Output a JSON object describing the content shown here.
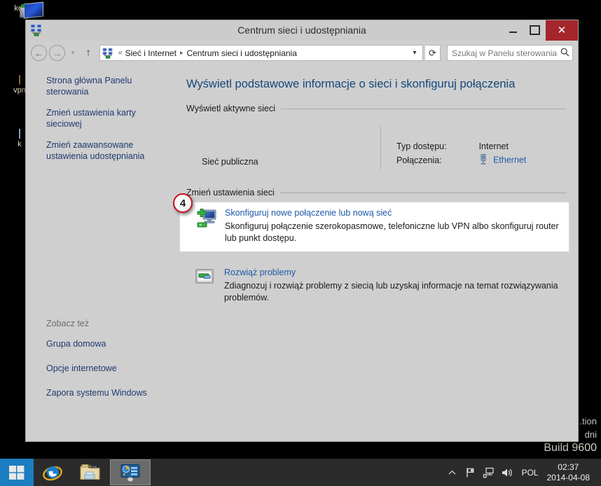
{
  "desktop": {
    "icons": [
      {
        "name": "komputer-icon",
        "label": "kor",
        "glyph": "monitor"
      },
      {
        "name": "vpn-folder-icon",
        "label": "vpn",
        "glyph": "folder"
      },
      {
        "name": "unknown-icon",
        "label": "k",
        "glyph": "blue"
      }
    ],
    "watermark": {
      "line1": "...tion",
      "line2": "dni",
      "build": "Build 9600"
    }
  },
  "window": {
    "title": "Centrum sieci i udostępniania",
    "app_icon": "network-icon",
    "controls": {
      "minimize": "–",
      "maximize": "❐",
      "close": "✕"
    },
    "toolbar": {
      "back": "←",
      "forward": "→",
      "recent_caret": "▾",
      "up": "↑",
      "refresh": "⟳"
    },
    "breadcrumb": {
      "icon": "network-icon",
      "overflow": "«",
      "items": [
        "Sieć i Internet",
        "Centrum sieci i udostępniania"
      ],
      "separator": "▸",
      "dropdown": "⌄"
    },
    "search": {
      "placeholder": "Szukaj w Panelu sterowania",
      "value": "",
      "icon": "search-icon"
    }
  },
  "sidebar": {
    "links": [
      "Strona główna Panelu sterowania",
      "Zmień ustawienia karty sieciowej",
      "Zmień zaawansowane ustawienia udostępniania"
    ],
    "see_also": {
      "title": "Zobacz też",
      "links": [
        "Grupa domowa",
        "Opcje internetowe",
        "Zapora systemu Windows"
      ]
    }
  },
  "content": {
    "heading": "Wyświetl podstawowe informacje o sieci i skonfiguruj połączenia",
    "active_networks": {
      "group_title": "Wyświetl aktywne sieci",
      "network_name": "Sieć publiczna",
      "access_type_label": "Typ dostępu:",
      "access_type_value": "Internet",
      "connections_label": "Połączenia:",
      "connections_value": "Ethernet",
      "connections_icon": "ethernet-icon"
    },
    "change_settings": {
      "group_title": "Zmień ustawienia sieci",
      "tasks": [
        {
          "icon": "new-connection-icon",
          "title": "Skonfiguruj nowe połączenie lub nową sieć",
          "description": "Skonfiguruj połączenie szerokopasmowe, telefoniczne lub VPN albo skonfiguruj router lub punkt dostępu.",
          "hovered": true
        },
        {
          "icon": "troubleshoot-icon",
          "title": "Rozwiąż problemy",
          "description": "Zdiagnozuj i rozwiąż problemy z siecią lub uzyskaj informacje na temat rozwiązywania problemów.",
          "hovered": false
        }
      ]
    }
  },
  "callout": {
    "number": "4"
  },
  "taskbar": {
    "start": {
      "name": "start-button",
      "label": "Start"
    },
    "items": [
      {
        "name": "taskbar-internet-explorer",
        "label": "Internet Explorer",
        "active": false
      },
      {
        "name": "taskbar-file-explorer",
        "label": "Eksplorator plików",
        "active": false
      },
      {
        "name": "taskbar-control-panel",
        "label": "Panel sterowania",
        "active": true
      }
    ],
    "tray": {
      "show_hidden": "▲",
      "action_center": "action-center-icon",
      "network": "network-tray-icon",
      "volume": "volume-icon",
      "language": "POL",
      "time": "02:37",
      "date": "2014-04-08"
    }
  },
  "colors": {
    "accent_link": "#1e5aa8",
    "heading": "#14477a",
    "close_button": "#a4262c",
    "window_chrome": "#cfcfcf",
    "taskbar": "#2b2b2b",
    "start_button": "#1b7ec1",
    "badge_ring": "#c0141c"
  }
}
